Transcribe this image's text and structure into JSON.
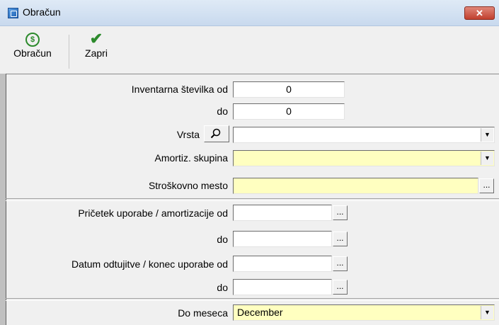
{
  "window": {
    "title": "Obračun",
    "close_label": "✕"
  },
  "toolbar": {
    "obracun_label": "Obračun",
    "zapri_label": "Zapri"
  },
  "form": {
    "inv_from_label": "Inventarna številka od",
    "inv_from_value": "0",
    "inv_to_label": "do",
    "inv_to_value": "0",
    "vrsta_label": "Vrsta",
    "vrsta_value": "",
    "amort_label": "Amortiz. skupina",
    "amort_value": "",
    "strosk_label": "Stroškovno mesto",
    "strosk_value": "",
    "pricetek_from_label": "Pričetek uporabe / amortizacije od",
    "pricetek_from_value": "",
    "pricetek_to_label": "do",
    "pricetek_to_value": "",
    "datum_from_label": "Datum odtujitve / konec uporabe od",
    "datum_from_value": "",
    "datum_to_label": "do",
    "datum_to_value": "",
    "meseca_label": "Do meseca",
    "meseca_value": "December"
  },
  "icons": {
    "dropdown": "▼",
    "ellipsis": "...",
    "search": "magnifier-icon"
  },
  "colors": {
    "required_field": "#ffffc0",
    "titlebar": "#c8d9ee",
    "close": "#c1402e"
  }
}
